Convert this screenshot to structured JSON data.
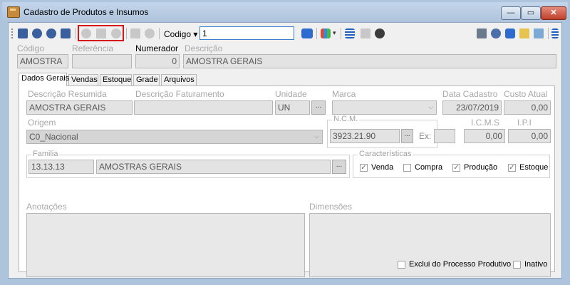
{
  "window": {
    "title": "Cadastro de Produtos e Insumos",
    "min": "—",
    "max": "▭",
    "close": "✕"
  },
  "toolbar": {
    "codigo_label": "Codigo ▾",
    "code_value": "1"
  },
  "header": {
    "codigo_label": "Código",
    "codigo_value": "AMOSTRA",
    "referencia_label": "Referência",
    "referencia_value": "",
    "numerador_label": "Numerador",
    "numerador_value": "0",
    "descricao_label": "Descrição",
    "descricao_value": "AMOSTRA GERAIS"
  },
  "tabs": [
    "Dados Gerais",
    "Vendas",
    "Estoque",
    "Grade",
    "Arquivos"
  ],
  "dados_gerais": {
    "desc_resumida_label": "Descrição Resumida",
    "desc_resumida_value": "AMOSTRA GERAIS",
    "desc_fat_label": "Descrição Faturamento",
    "desc_fat_value": "",
    "unidade_label": "Unidade",
    "unidade_value": "UN",
    "marca_label": "Marca",
    "marca_value": "",
    "data_cadastro_label": "Data Cadastro",
    "data_cadastro_value": "23/07/2019",
    "custo_label": "Custo Atual",
    "custo_value": "0,00",
    "origem_label": "Origem",
    "origem_value": "C0_Nacional",
    "ncm_label": "N.C.M.",
    "ncm_value": "3923.21.90",
    "ex_label": "Ex:",
    "ex_value": "",
    "icms_label": "I.C.M.S",
    "icms_value": "0,00",
    "ipi_label": "I.P.I",
    "ipi_value": "0,00",
    "familia_label": "Familia",
    "familia_code": "13.13.13",
    "familia_desc": "AMOSTRAS GERAIS",
    "caracteristicas_label": "Características",
    "venda_label": "Venda",
    "compra_label": "Compra",
    "producao_label": "Produção",
    "estoque_label": "Estoque",
    "anotacoes_label": "Anotações",
    "dimensoes_label": "Dimensões",
    "exclui_label": "Exclui do Processo Produtivo",
    "inativo_label": "Inativo"
  },
  "checks": {
    "venda": "✓",
    "compra": "",
    "producao": "✓",
    "estoque": "✓"
  },
  "ellipsis": "..."
}
